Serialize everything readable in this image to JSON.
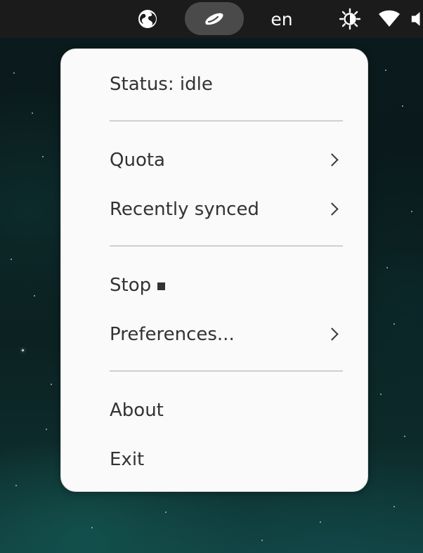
{
  "topbar": {
    "icons": [
      "globe-icon",
      "cloud-sync-icon",
      "brightness-icon",
      "wifi-icon",
      "speaker-icon"
    ],
    "language": "en"
  },
  "menu": {
    "status": "Status: idle",
    "quota": "Quota",
    "recently_synced": "Recently synced",
    "stop": "Stop",
    "preferences": "Preferences...",
    "about": "About",
    "exit": "Exit"
  },
  "colors": {
    "topbar_bg": "#1b1b1b",
    "menu_bg": "#fafafa",
    "menu_text": "#333333",
    "separator": "#cfcfcf",
    "active_indicator": "#4a4a4a"
  }
}
